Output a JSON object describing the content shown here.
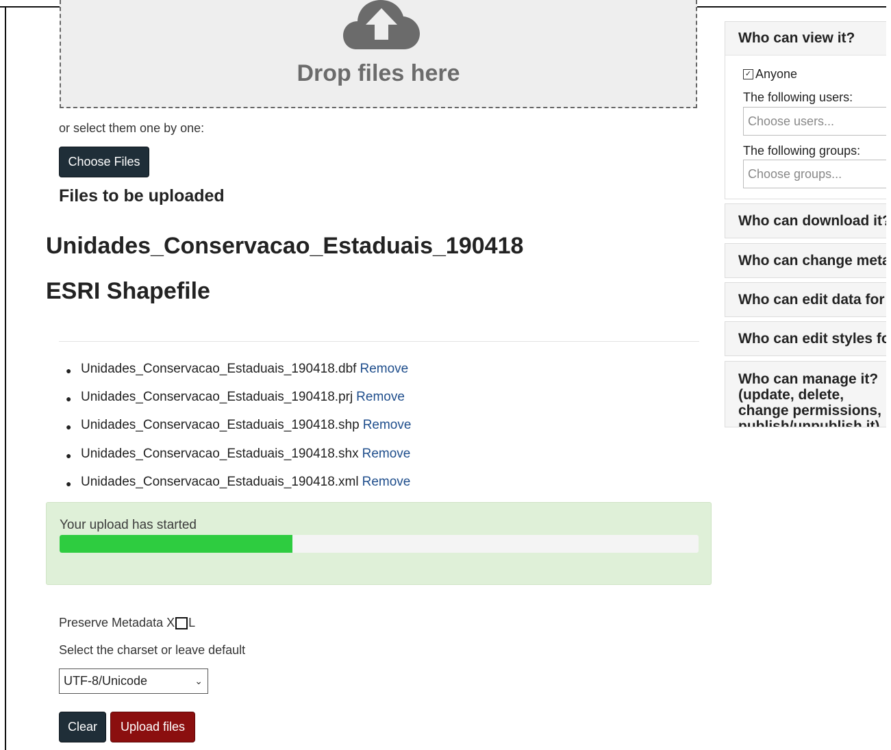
{
  "dropzone": {
    "text": "Drop files here"
  },
  "select_text": "or select them one by one:",
  "choose_files_label": "Choose Files",
  "files_heading": "Files to be uploaded",
  "layer_name": "Unidades_Conservacao_Estaduais_190418",
  "layer_type": "ESRI Shapefile",
  "remove_label": "Remove",
  "files": [
    "Unidades_Conservacao_Estaduais_190418.dbf",
    "Unidades_Conservacao_Estaduais_190418.prj",
    "Unidades_Conservacao_Estaduais_190418.shp",
    "Unidades_Conservacao_Estaduais_190418.shx",
    "Unidades_Conservacao_Estaduais_190418.xml"
  ],
  "upload_status": {
    "text": "Your upload has started",
    "progress_fraction": 0.364
  },
  "preserve_metadata": {
    "prefix": "Preserve Metadata X",
    "suffix": "L",
    "checked": false
  },
  "charset": {
    "label": "Select the charset or leave default",
    "selected": "UTF-8/Unicode"
  },
  "buttons": {
    "clear": "Clear",
    "upload": "Upload files"
  },
  "permissions": {
    "view": {
      "title": "Who can view it?",
      "anyone_label": "Anyone",
      "anyone_checked": true,
      "users_label": "The following users:",
      "users_placeholder": "Choose users...",
      "groups_label": "The following groups:",
      "groups_placeholder": "Choose groups..."
    },
    "download_title": "Who can download it?",
    "change_meta_title": "Who can change metadata for it?",
    "edit_data_title": "Who can edit data for this layer?",
    "edit_styles_title": "Who can edit styles for this layer?",
    "manage_title": "Who can manage it? (update, delete, change permissions, publish/unpublish it)"
  },
  "colors": {
    "dark_button": "#1f2e38",
    "upload_button": "#8b0f0f",
    "progress": "#2ecc40",
    "alert_bg": "#dff0d8",
    "link": "#1f4e8c"
  }
}
